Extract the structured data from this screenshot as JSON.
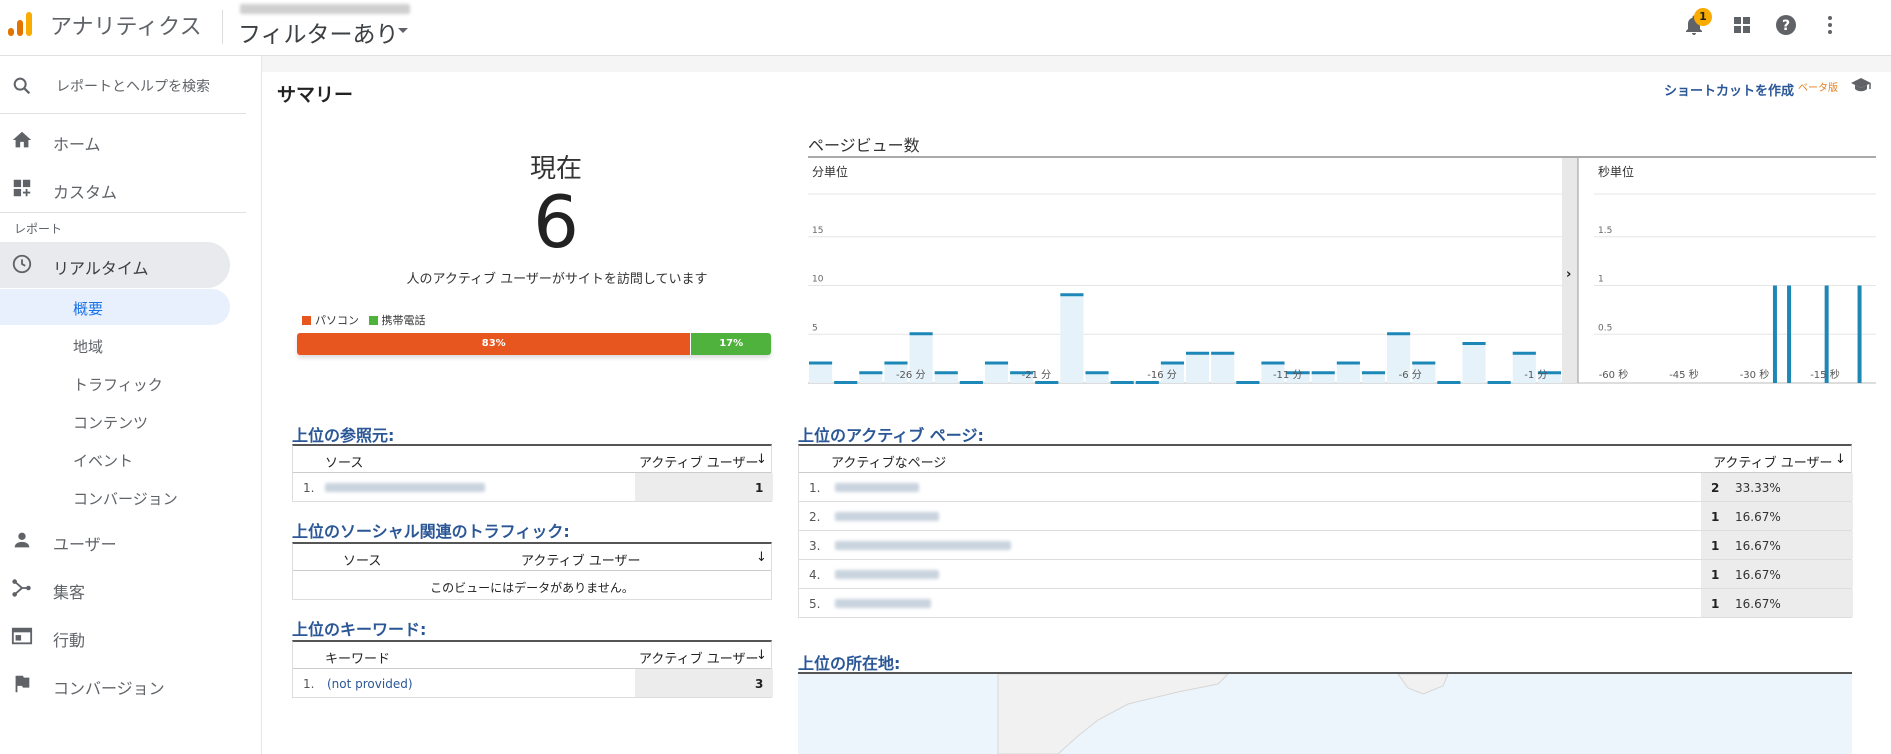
{
  "header": {
    "app_name": "アナリティクス",
    "view_name": "フィルターあり",
    "notification_count": "1",
    "icons": [
      "analytics-logo-icon",
      "bell-icon",
      "apps-grid-icon",
      "help-icon",
      "more-vert-icon"
    ]
  },
  "sidebar": {
    "search_placeholder": "レポートとヘルプを検索",
    "home": "ホーム",
    "custom": "カスタム",
    "report_section": "レポート",
    "realtime": "リアルタイム",
    "realtime_sub": [
      "概要",
      "地域",
      "トラフィック",
      "コンテンツ",
      "イベント",
      "コンバージョン"
    ],
    "users": "ユーザー",
    "acquisition": "集客",
    "behavior": "行動",
    "conversion": "コンバージョン"
  },
  "main": {
    "title": "サマリー",
    "shortcut": "ショートカットを作成",
    "beta": "ベータ版",
    "now_label": "現在",
    "active_users": "6",
    "caption": "人のアクティブ ユーザーがサイトを訪問しています",
    "device_legend": [
      {
        "label": "パソコン",
        "color": "#e8561f"
      },
      {
        "label": "携帯電話",
        "color": "#4fb23d"
      }
    ],
    "device_share": [
      {
        "label": "83%",
        "value": 83,
        "color": "#e8561f"
      },
      {
        "label": "17%",
        "value": 17,
        "color": "#4fb23d"
      }
    ]
  },
  "chart_data": [
    {
      "type": "bar",
      "title": "ページビュー数",
      "subtitle": "分単位",
      "ylim": [
        0,
        20
      ],
      "yticks": [
        5,
        10,
        15
      ],
      "xtick_labels": [
        "-26 分",
        "-21 分",
        "-16 分",
        "-11 分",
        "-6 分",
        "-1 分"
      ],
      "values": [
        2,
        0,
        1,
        2,
        5,
        1,
        0,
        2,
        1,
        0,
        9,
        1,
        0,
        0,
        2,
        3,
        3,
        0,
        2,
        1,
        1,
        2,
        1,
        5,
        2,
        0,
        4,
        0,
        3,
        1
      ]
    },
    {
      "type": "bar",
      "subtitle": "秒単位",
      "ylim": [
        0,
        2
      ],
      "yticks": [
        0.5,
        1,
        1.5
      ],
      "xtick_labels": [
        "-60 秒",
        "-45 秒",
        "-30 秒",
        "-15 秒"
      ],
      "values": [
        0,
        0,
        0,
        0,
        0,
        0,
        0,
        0,
        0,
        0,
        0,
        0,
        0,
        0,
        0,
        0,
        0,
        0,
        0,
        0,
        0,
        0,
        0,
        0,
        0,
        0,
        0,
        0,
        0,
        0,
        0,
        0,
        0,
        0,
        0,
        0,
        0,
        0,
        1,
        0,
        0,
        1,
        0,
        0,
        0,
        0,
        0,
        0,
        0,
        1,
        0,
        0,
        0,
        0,
        0,
        0,
        1,
        0,
        0,
        0
      ]
    }
  ],
  "referrers": {
    "title": "上位の参照元:",
    "col_source": "ソース",
    "col_users": "アクティブ ユーザー",
    "rows": [
      {
        "num": "1.",
        "value": "1"
      }
    ]
  },
  "social": {
    "title": "上位のソーシャル関連のトラフィック:",
    "col_source": "ソース",
    "col_users": "アクティブ ユーザー",
    "empty": "このビューにはデータがありません。"
  },
  "keywords": {
    "title": "上位のキーワード:",
    "col_keyword": "キーワード",
    "col_users": "アクティブ ユーザー",
    "rows": [
      {
        "num": "1.",
        "keyword": "(not provided)",
        "value": "3"
      }
    ]
  },
  "active_pages": {
    "title": "上位のアクティブ ページ:",
    "col_page": "アクティブなページ",
    "col_users": "アクティブ ユーザー",
    "rows": [
      {
        "num": "1.",
        "value": "2",
        "pct": "33.33%"
      },
      {
        "num": "2.",
        "value": "1",
        "pct": "16.67%"
      },
      {
        "num": "3.",
        "value": "1",
        "pct": "16.67%"
      },
      {
        "num": "4.",
        "value": "1",
        "pct": "16.67%"
      },
      {
        "num": "5.",
        "value": "1",
        "pct": "16.67%"
      }
    ]
  },
  "locations": {
    "title": "上位の所在地:"
  }
}
